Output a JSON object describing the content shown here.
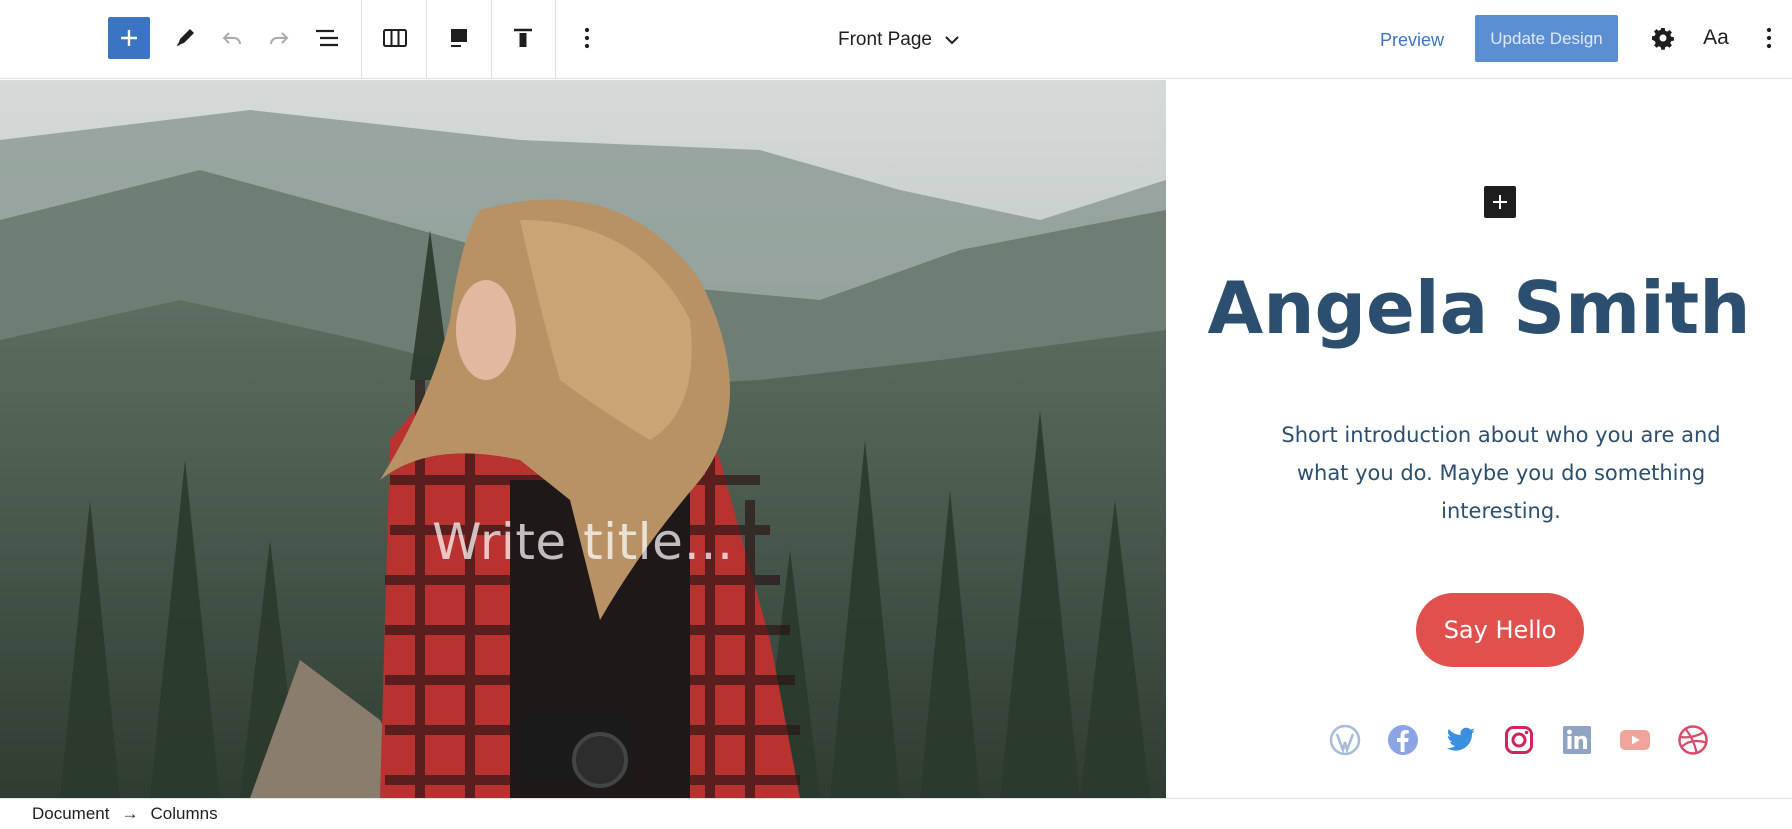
{
  "toolbar": {
    "add_icon": "plus-icon",
    "tools_icon": "pencil-icon",
    "undo_icon": "undo-icon",
    "redo_icon": "redo-icon",
    "list_view_icon": "list-view-icon",
    "columns_icon": "columns-icon",
    "media_icon": "media-left-icon",
    "align_icon": "align-top-icon",
    "more_icon": "vertical-ellipsis-icon",
    "document_title": "Front Page",
    "preview_label": "Preview",
    "update_label": "Update Design",
    "settings_icon": "gear-icon",
    "styles_label": "Aa",
    "options_icon": "vertical-ellipsis-icon"
  },
  "cover": {
    "title_placeholder": "Write title…"
  },
  "profile": {
    "name": "Angela Smith",
    "intro": "Short introduction about who you are and what you do. Maybe you do something interesting.",
    "button_label": "Say Hello",
    "socials": [
      {
        "name": "wordpress",
        "color": "#a8bbd8"
      },
      {
        "name": "facebook",
        "color": "#8aa4e4"
      },
      {
        "name": "twitter",
        "color": "#3b8fe0"
      },
      {
        "name": "instagram",
        "color": "#d0265c"
      },
      {
        "name": "linkedin",
        "color": "#8fa3c4"
      },
      {
        "name": "youtube",
        "color": "#f0a59c"
      },
      {
        "name": "dribbble",
        "color": "#d84a6a"
      }
    ]
  },
  "breadcrumb": {
    "root": "Document",
    "separator": "→",
    "current": "Columns"
  },
  "colors": {
    "accent": "#3c74c4",
    "name_color": "#2c4f6f",
    "button_color": "#e0514d"
  }
}
